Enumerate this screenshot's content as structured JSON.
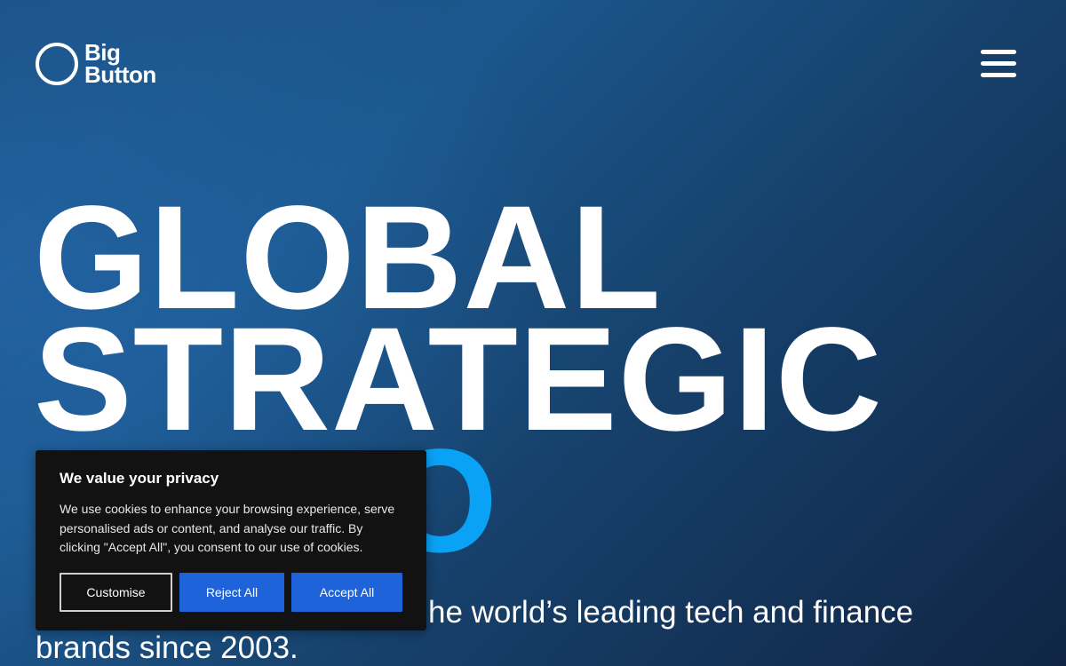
{
  "header": {
    "logo": {
      "line1": "Big",
      "line2": "Button"
    },
    "menu_icon": "hamburger-menu-icon"
  },
  "hero": {
    "headline": {
      "line1": "GLOBAL",
      "line2": "STRATEGIC",
      "line3_partial": "O"
    },
    "accent_color": "#0aa2f5",
    "tagline": "the world’s leading tech and finance brands since 2003.",
    "tagline_visible_part": "he world’s leading tech and finance",
    "tagline_line2": "brands since 2003."
  },
  "cookie_banner": {
    "title": "We value your privacy",
    "body": "We use cookies to enhance your browsing experience, serve personalised ads or content, and analyse our traffic. By clicking \"Accept All\", you consent to our use of cookies.",
    "buttons": {
      "customise": "Customise",
      "reject": "Reject All",
      "accept": "Accept All"
    },
    "button_color": "#1e63d9"
  }
}
